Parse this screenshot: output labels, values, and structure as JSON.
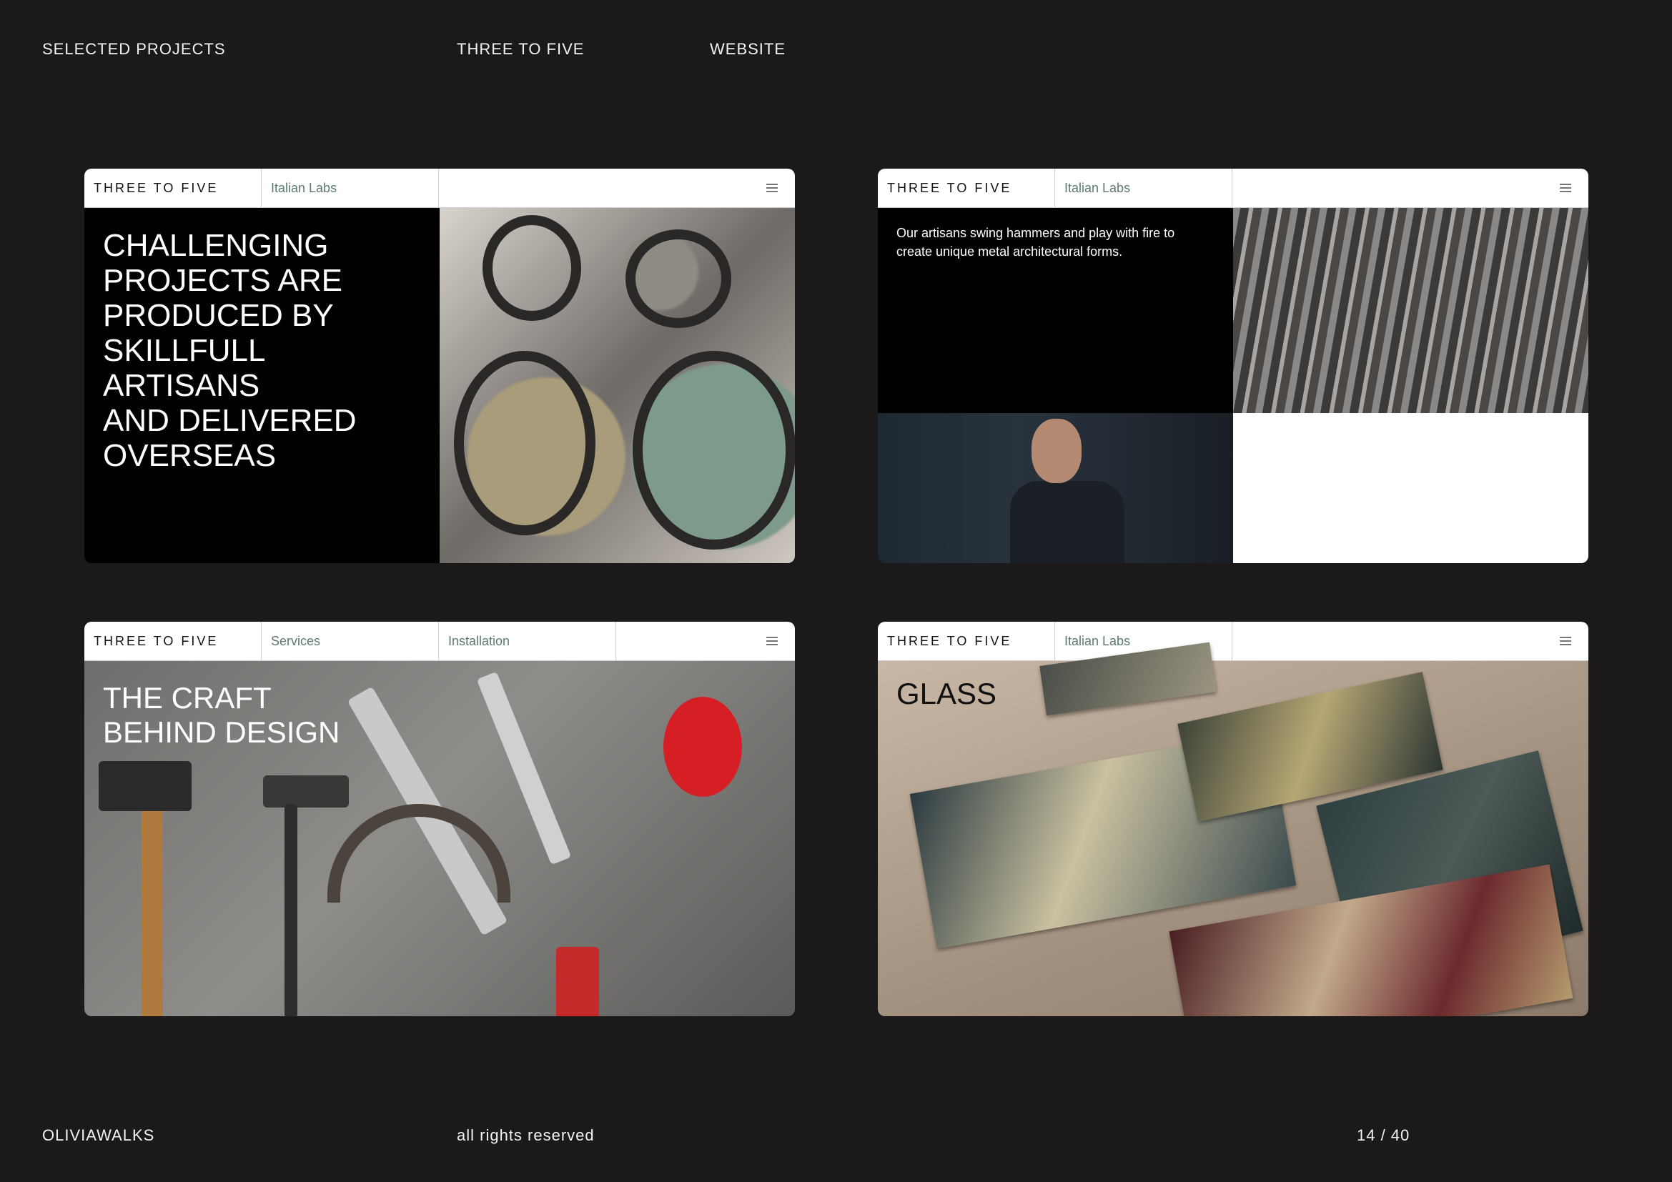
{
  "header": {
    "section": "SELECTED PROJECTS",
    "client": "THREE TO FIVE",
    "type": "WEBSITE"
  },
  "cards": [
    {
      "brand": "THREE TO FIVE",
      "nav": [
        "Italian Labs"
      ],
      "headline": "CHALLENGING\nPROJECTS ARE\nPRODUCED BY\nSKILLFULL\nARTISANS\nAND DELIVERED\nOVERSEAS"
    },
    {
      "brand": "THREE TO FIVE",
      "nav": [
        "Italian Labs"
      ],
      "body": "Our artisans swing hammers and play with fire to create unique metal architectural forms."
    },
    {
      "brand": "THREE TO FIVE",
      "nav": [
        "Services",
        "Installation"
      ],
      "headline": "THE CRAFT\nBEHIND DESIGN"
    },
    {
      "brand": "THREE TO FIVE",
      "nav": [
        "Italian Labs"
      ],
      "headline": "GLASS"
    }
  ],
  "footer": {
    "author": "OLIVIAWALKS",
    "rights": "all rights reserved",
    "page": "14 / 40"
  }
}
